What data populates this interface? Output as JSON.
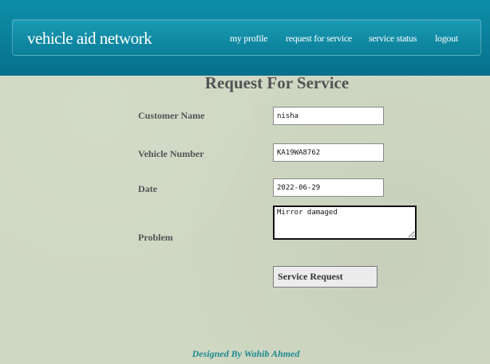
{
  "header": {
    "brand": "vehicle aid network",
    "nav": {
      "my_profile": "my profile",
      "request_for_service": "request for service",
      "service_status": "service status",
      "logout": "logout"
    }
  },
  "form": {
    "title": "Request For Service",
    "customer_name": {
      "label": "Customer Name",
      "value": "nisha"
    },
    "vehicle_number": {
      "label": "Vehicle Number",
      "value": "KA19WA8762"
    },
    "date": {
      "label": "Date",
      "value": "2022-06-29"
    },
    "problem": {
      "label": "Problem",
      "value": "Mirror damaged"
    },
    "submit_label": "Service Request"
  },
  "footer": {
    "credit": "Designed By Wahib Ahmed"
  },
  "colors": {
    "header_bg": "#0b7f99",
    "page_bg": "#cfd8c3",
    "label_text": "#545454",
    "footer_text": "#1f8a8f"
  }
}
